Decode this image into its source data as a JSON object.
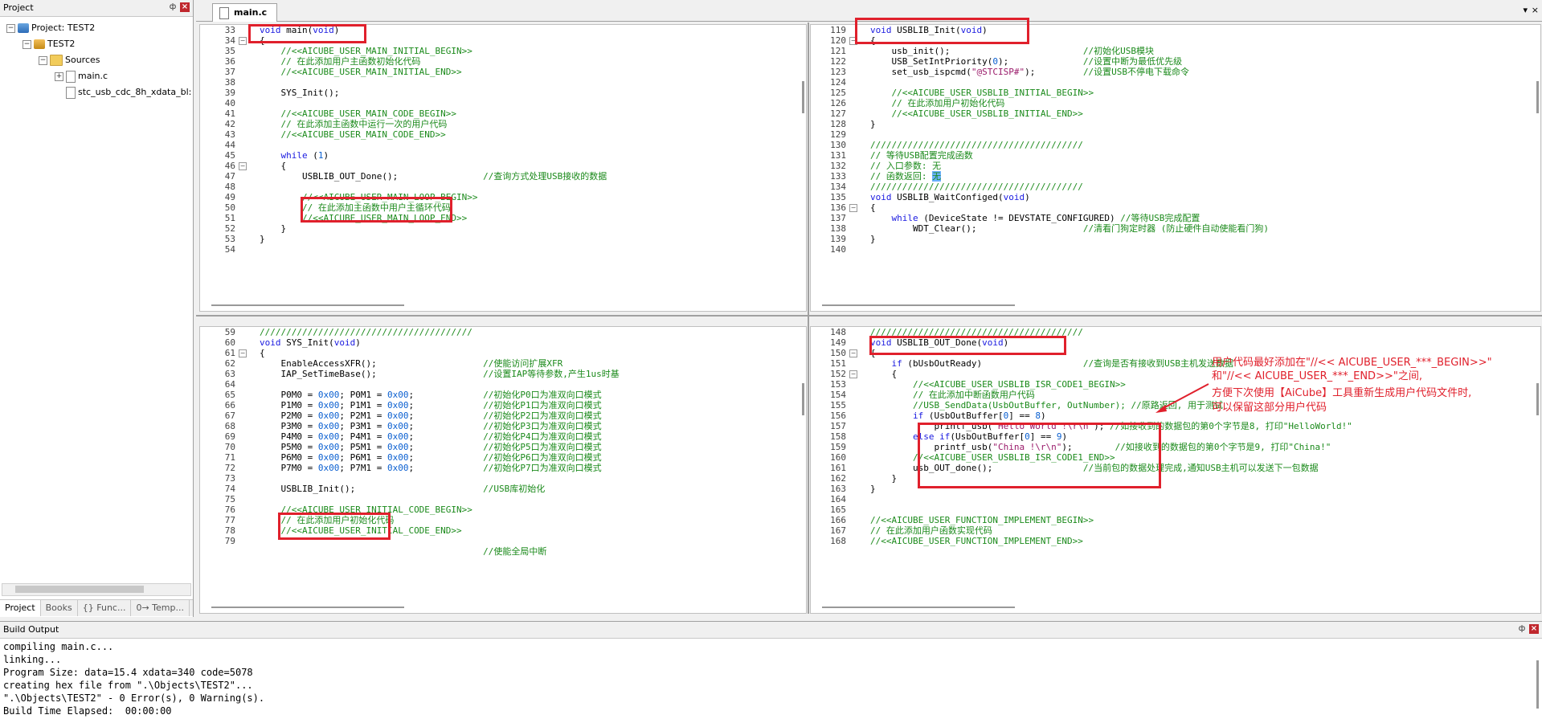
{
  "project_panel": {
    "title": "Project",
    "pin_label": "ф",
    "close_label": "×",
    "tree": {
      "project": "Project: TEST2",
      "target": "TEST2",
      "group": "Sources",
      "file1": "main.c",
      "file2": "stc_usb_cdc_8h_xdata_bl:"
    },
    "tabs": [
      "Project",
      "Books",
      "{} Func...",
      "0→ Temp..."
    ]
  },
  "editor": {
    "file_tab": "main.c",
    "tab_menu_icon": "▾",
    "tab_close_icon": "×",
    "panes": {
      "top_left": [
        {
          "ln": "33",
          "code": "void main(void)"
        },
        {
          "ln": "34",
          "code": "{"
        },
        {
          "ln": "35",
          "code": "    //<<AICUBE_USER_MAIN_INITIAL_BEGIN>>"
        },
        {
          "ln": "36",
          "code": "    // 在此添加用户主函数初始化代码"
        },
        {
          "ln": "37",
          "code": "    //<<AICUBE_USER_MAIN_INITIAL_END>>"
        },
        {
          "ln": "38",
          "code": ""
        },
        {
          "ln": "39",
          "code": "    SYS_Init();"
        },
        {
          "ln": "40",
          "code": ""
        },
        {
          "ln": "41",
          "code": "    //<<AICUBE_USER_MAIN_CODE_BEGIN>>"
        },
        {
          "ln": "42",
          "code": "    // 在此添加主函数中运行一次的用户代码"
        },
        {
          "ln": "43",
          "code": "    //<<AICUBE_USER_MAIN_CODE_END>>"
        },
        {
          "ln": "44",
          "code": ""
        },
        {
          "ln": "45",
          "code": "    while (1)"
        },
        {
          "ln": "46",
          "code": "    {"
        },
        {
          "ln": "47",
          "code": "        USBLIB_OUT_Done();                //查询方式处理USB接收的数据"
        },
        {
          "ln": "48",
          "code": ""
        },
        {
          "ln": "49",
          "code": "        //<<AICUBE_USER_MAIN_LOOP_BEGIN>>"
        },
        {
          "ln": "50",
          "code": "        // 在此添加主函数中用户主循环代码"
        },
        {
          "ln": "51",
          "code": "        //<<AICUBE_USER_MAIN_LOOP_END>>"
        },
        {
          "ln": "52",
          "code": "    }"
        },
        {
          "ln": "53",
          "code": "}"
        },
        {
          "ln": "54",
          "code": ""
        }
      ],
      "top_right": [
        {
          "ln": "119",
          "code": "void USBLIB_Init(void)"
        },
        {
          "ln": "120",
          "code": "{"
        },
        {
          "ln": "121",
          "code": "    usb_init();                         //初始化USB模块"
        },
        {
          "ln": "122",
          "code": "    USB_SetIntPriority(0);              //设置中断为最低优先级"
        },
        {
          "ln": "123",
          "code": "    set_usb_ispcmd(\"@STCISP#\");         //设置USB不停电下载命令"
        },
        {
          "ln": "124",
          "code": ""
        },
        {
          "ln": "125",
          "code": "    //<<AICUBE_USER_USBLIB_INITIAL_BEGIN>>"
        },
        {
          "ln": "126",
          "code": "    // 在此添加用户初始化代码"
        },
        {
          "ln": "127",
          "code": "    //<<AICUBE_USER_USBLIB_INITIAL_END>>"
        },
        {
          "ln": "128",
          "code": "}"
        },
        {
          "ln": "129",
          "code": ""
        },
        {
          "ln": "130",
          "code": "////////////////////////////////////////"
        },
        {
          "ln": "131",
          "code": "// 等待USB配置完成函数"
        },
        {
          "ln": "132",
          "code": "// 入口参数: 无"
        },
        {
          "ln": "133",
          "code": "// 函数返回: 无"
        },
        {
          "ln": "134",
          "code": "////////////////////////////////////////"
        },
        {
          "ln": "135",
          "code": "void USBLIB_WaitConfiged(void)"
        },
        {
          "ln": "136",
          "code": "{"
        },
        {
          "ln": "137",
          "code": "    while (DeviceState != DEVSTATE_CONFIGURED) //等待USB完成配置"
        },
        {
          "ln": "138",
          "code": "        WDT_Clear();                    //清看门狗定时器 (防止硬件自动使能看门狗)"
        },
        {
          "ln": "139",
          "code": "}"
        },
        {
          "ln": "140",
          "code": ""
        }
      ],
      "bottom_left": [
        {
          "ln": "59",
          "code": "////////////////////////////////////////"
        },
        {
          "ln": "60",
          "code": "void SYS_Init(void)"
        },
        {
          "ln": "61",
          "code": "{"
        },
        {
          "ln": "62",
          "code": "    EnableAccessXFR();                    //使能访问扩展XFR"
        },
        {
          "ln": "63",
          "code": "    IAP_SetTimeBase();                    //设置IAP等待参数,产生1us时基"
        },
        {
          "ln": "64",
          "code": ""
        },
        {
          "ln": "65",
          "code": "    P0M0 = 0x00; P0M1 = 0x00;             //初始化P0口为准双向口模式"
        },
        {
          "ln": "66",
          "code": "    P1M0 = 0x00; P1M1 = 0x00;             //初始化P1口为准双向口模式"
        },
        {
          "ln": "67",
          "code": "    P2M0 = 0x00; P2M1 = 0x00;             //初始化P2口为准双向口模式"
        },
        {
          "ln": "68",
          "code": "    P3M0 = 0x00; P3M1 = 0x00;             //初始化P3口为准双向口模式"
        },
        {
          "ln": "69",
          "code": "    P4M0 = 0x00; P4M1 = 0x00;             //初始化P4口为准双向口模式"
        },
        {
          "ln": "70",
          "code": "    P5M0 = 0x00; P5M1 = 0x00;             //初始化P5口为准双向口模式"
        },
        {
          "ln": "71",
          "code": "    P6M0 = 0x00; P6M1 = 0x00;             //初始化P6口为准双向口模式"
        },
        {
          "ln": "72",
          "code": "    P7M0 = 0x00; P7M1 = 0x00;             //初始化P7口为准双向口模式"
        },
        {
          "ln": "73",
          "code": ""
        },
        {
          "ln": "74",
          "code": "    USBLIB_Init();                        //USB库初始化"
        },
        {
          "ln": "75",
          "code": ""
        },
        {
          "ln": "76",
          "code": "    //<<AICUBE_USER_INITIAL_CODE_BEGIN>>"
        },
        {
          "ln": "77",
          "code": "    // 在此添加用户初始化代码"
        },
        {
          "ln": "78",
          "code": "    //<<AICUBE_USER_INITIAL_CODE_END>>"
        },
        {
          "ln": "79",
          "code": ""
        },
        {
          "ln": "",
          "code": "                                          //使能全局中断"
        }
      ],
      "bottom_right": [
        {
          "ln": "148",
          "code": "////////////////////////////////////////"
        },
        {
          "ln": "149",
          "code": "void USBLIB_OUT_Done(void)"
        },
        {
          "ln": "150",
          "code": "{"
        },
        {
          "ln": "151",
          "code": "    if (bUsbOutReady)                   //查询是否有接收到USB主机发送数据"
        },
        {
          "ln": "152",
          "code": "    {"
        },
        {
          "ln": "153",
          "code": "        //<<AICUBE_USER_USBLIB_ISR_CODE1_BEGIN>>"
        },
        {
          "ln": "154",
          "code": "        // 在此添加中断函数用户代码"
        },
        {
          "ln": "155",
          "code": "        //USB_SendData(UsbOutBuffer, OutNumber); //原路返回, 用于测试"
        },
        {
          "ln": "156",
          "code": "        if (UsbOutBuffer[0] == 8)"
        },
        {
          "ln": "157",
          "code": "            printf_usb(\"Hello World !\\r\\n\"); //如接收到的数据包的第0个字节是8, 打印\"HelloWorld!\""
        },
        {
          "ln": "158",
          "code": "        else if(UsbOutBuffer[0] == 9)"
        },
        {
          "ln": "159",
          "code": "            printf_usb(\"China !\\r\\n\");        //如接收到的数据包的第0个字节是9, 打印\"China!\""
        },
        {
          "ln": "160",
          "code": "        //<<AICUBE_USER_USBLIB_ISR_CODE1_END>>"
        },
        {
          "ln": "161",
          "code": "        usb_OUT_done();                 //当前包的数据处理完成,通知USB主机可以发送下一包数据"
        },
        {
          "ln": "162",
          "code": "    }"
        },
        {
          "ln": "163",
          "code": "}"
        },
        {
          "ln": "164",
          "code": ""
        },
        {
          "ln": "165",
          "code": ""
        },
        {
          "ln": "166",
          "code": "//<<AICUBE_USER_FUNCTION_IMPLEMENT_BEGIN>>"
        },
        {
          "ln": "167",
          "code": "// 在此添加用户函数实现代码"
        },
        {
          "ln": "168",
          "code": "//<<AICUBE_USER_FUNCTION_IMPLEMENT_END>>"
        }
      ]
    },
    "annotation": {
      "line1": "用户代码最好添加在\"//<< AICUBE_USER_***_BEGIN>>\"",
      "line2": "和\"//<< AICUBE_USER_***_END>>\"之间,",
      "line3": "方便下次使用【AiCube】工具重新生成用户代码文件时,",
      "line4": "可以保留这部分用户代码"
    }
  },
  "build_output": {
    "title": "Build Output",
    "lines": [
      "compiling main.c...",
      "linking...",
      "Program Size: data=15.4 xdata=340 code=5078",
      "creating hex file from \".\\Objects\\TEST2\"...",
      "\".\\Objects\\TEST2\" - 0 Error(s), 0 Warning(s).",
      "Build Time Elapsed:  00:00:00"
    ]
  },
  "colors": {
    "comment": "#1b8a1b",
    "keyword": "#1a1ae0",
    "number": "#0a5fd0",
    "string": "#9a1a6a",
    "highlight_box": "#e0202c",
    "selection": "#6ab0ff"
  }
}
